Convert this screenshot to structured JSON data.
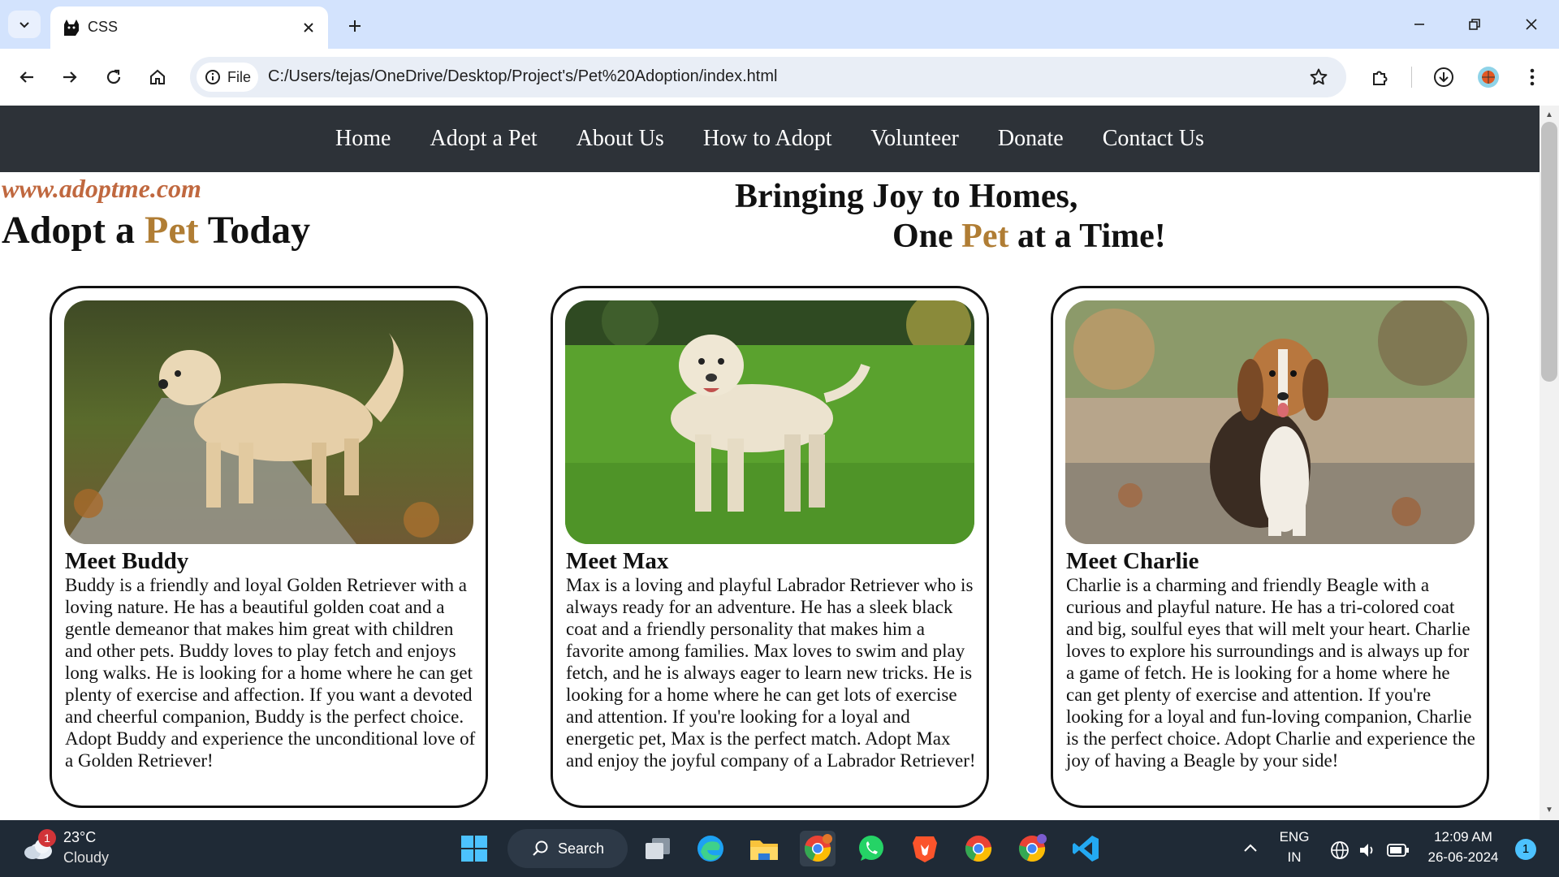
{
  "browser": {
    "tab_title": "CSS",
    "site_chip_label": "File",
    "url": "C:/Users/tejas/OneDrive/Desktop/Project's/Pet%20Adoption/index.html"
  },
  "site": {
    "nav": [
      "Home",
      "Adopt a Pet",
      "About Us",
      "How to Adopt",
      "Volunteer",
      "Donate",
      "Contact Us"
    ],
    "brand_url": "www.adoptme.com",
    "brand_title": {
      "pre": "Adopt a ",
      "accent": "Pet",
      "post": " Today"
    },
    "tagline_line1": "Bringing Joy to Homes,",
    "tagline_line2": {
      "pre": "One ",
      "accent": "Pet",
      "post": " at a Time!"
    },
    "colors": {
      "nav_bg": "#2d3238",
      "accent": "#b07d34",
      "brand_url": "#c0683f"
    },
    "pets": [
      {
        "title": "Meet Buddy",
        "description": "Buddy is a friendly and loyal Golden Retriever with a loving nature. He has a beautiful golden coat and a gentle demeanor that makes him great with children and other pets. Buddy loves to play fetch and enjoys long walks. He is looking for a home where he can get plenty of exercise and affection. If you want a devoted and cheerful companion, Buddy is the perfect choice. Adopt Buddy and experience the unconditional love of a Golden Retriever!"
      },
      {
        "title": "Meet Max",
        "description": "Max is a loving and playful Labrador Retriever who is always ready for an adventure. He has a sleek black coat and a friendly personality that makes him a favorite among families. Max loves to swim and play fetch, and he is always eager to learn new tricks. He is looking for a home where he can get lots of exercise and attention. If you're looking for a loyal and energetic pet, Max is the perfect match. Adopt Max and enjoy the joyful company of a Labrador Retriever!"
      },
      {
        "title": "Meet Charlie",
        "description": "Charlie is a charming and friendly Beagle with a curious and playful nature. He has a tri-colored coat and big, soulful eyes that will melt your heart. Charlie loves to explore his surroundings and is always up for a game of fetch. He is looking for a home where he can get plenty of exercise and attention. If you're looking for a loyal and fun-loving companion, Charlie is the perfect choice. Adopt Charlie and experience the joy of having a Beagle by your side!"
      }
    ]
  },
  "taskbar": {
    "weather_temp": "23°C",
    "weather_desc": "Cloudy",
    "weather_badge": "1",
    "search_label": "Search",
    "lang_line1": "ENG",
    "lang_line2": "IN",
    "time": "12:09 AM",
    "date": "26-06-2024",
    "notification_count": "1"
  }
}
